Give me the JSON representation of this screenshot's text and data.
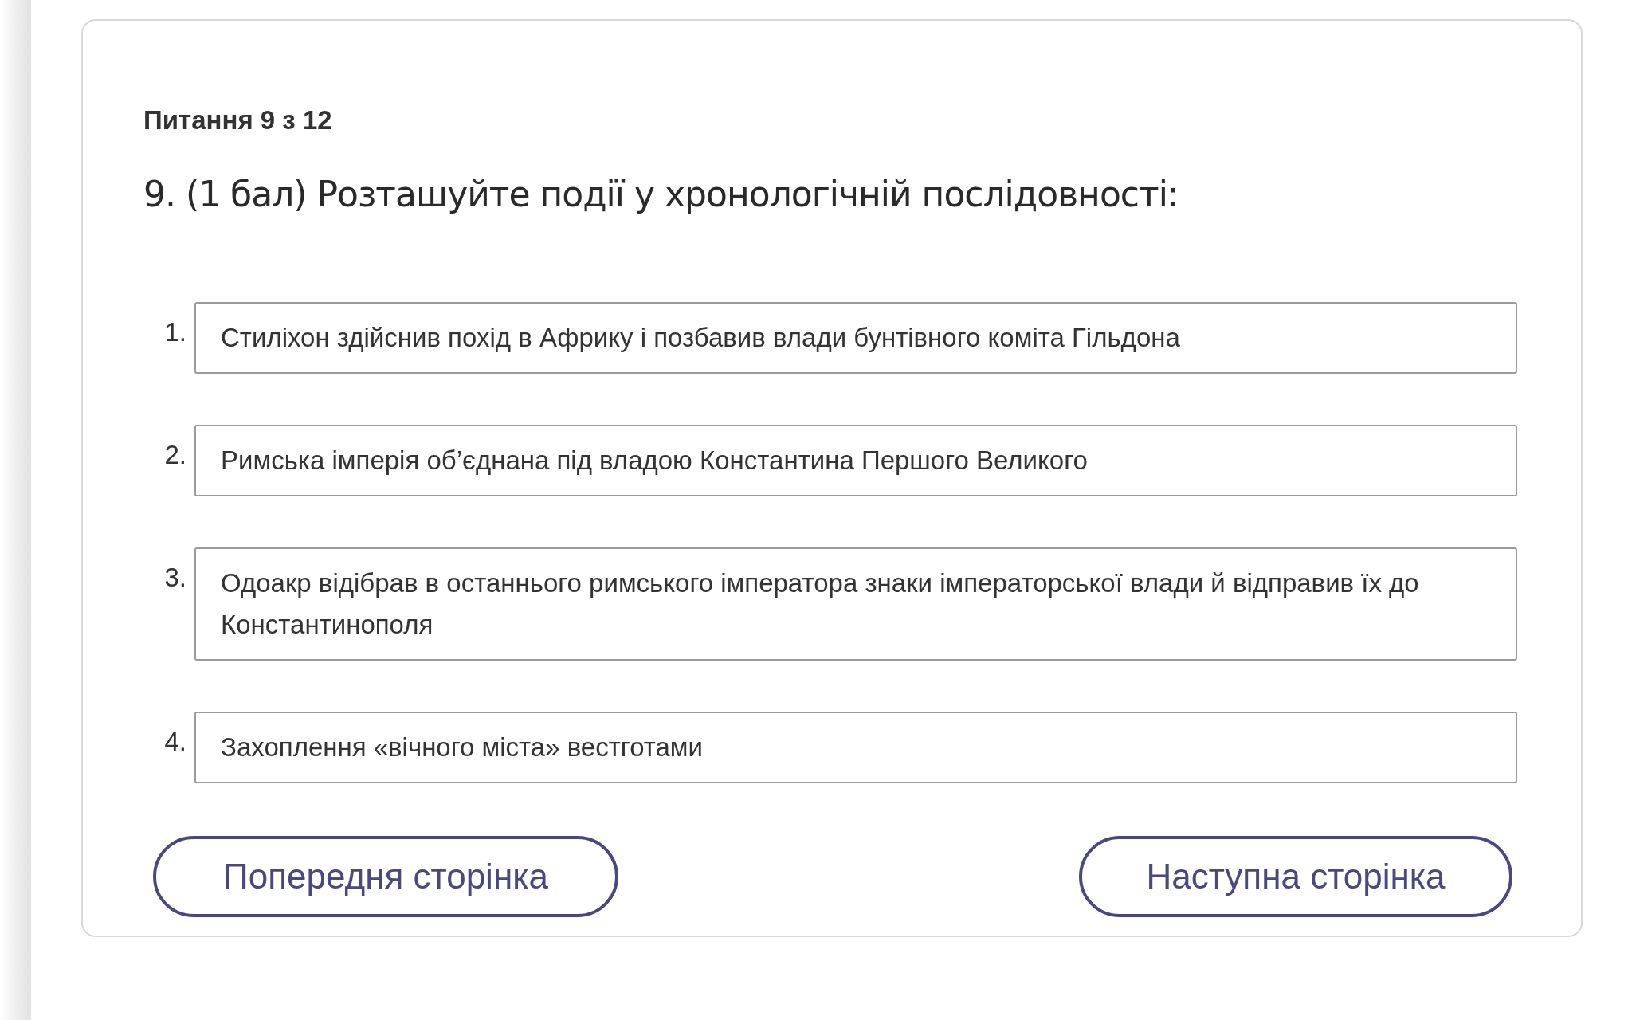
{
  "counter": "Питання 9 з 12",
  "question": "9. (1 бал) Розташуйте події у хронологічній послідовності:",
  "items": [
    {
      "number": "1.",
      "text": "Стиліхон здійснив похід в Африку і позбавив влади бунтівного коміта Гільдона"
    },
    {
      "number": "2.",
      "text": "Римська імперія об’єднана під владою Константина Першого Великого"
    },
    {
      "number": "3.",
      "text": "Одоакр відібрав в останнього римського імператора знаки імператорської влади й відправив їх до Константинополя"
    },
    {
      "number": "4.",
      "text": "Захоплення «вічного міста» вестготами"
    }
  ],
  "buttons": {
    "previous": "Попередня сторінка",
    "next": "Наступна сторінка"
  }
}
